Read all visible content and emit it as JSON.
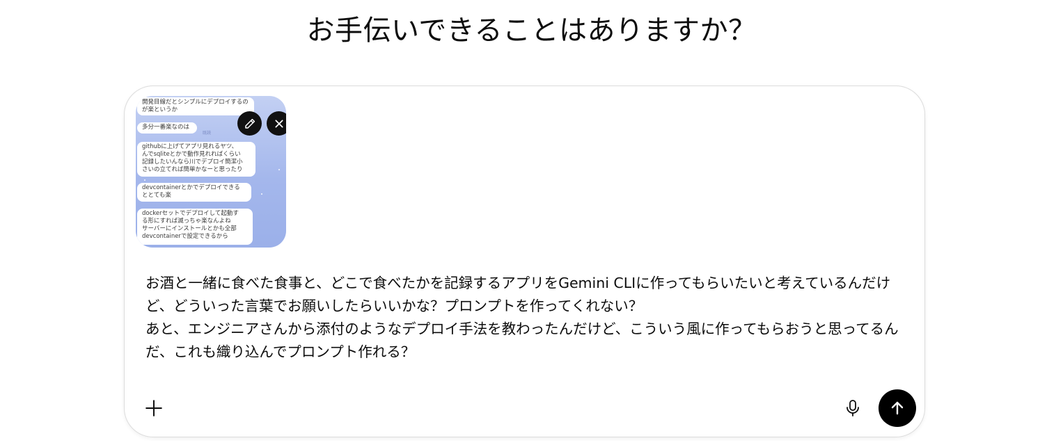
{
  "heading": "お手伝いできることはありますか？",
  "attachment": {
    "bubbles": [
      "開発目線だとシンプルにデプロイするのが楽というか",
      "多分一番楽なのは",
      "githubに上げてアプリ見れるヤツ、\nんでsqliteとかで動作見れればくらい\n記録したいんなら川でデプロイ簡潔小\nさいの立てれば簡単かなーと思ったり",
      "devcontainerとかでデプロイできる\nととても楽",
      "dockerセットでデプロイして起動す\nる形にすれば滅っちゃ楽なんよね\nサーバーにインストールとかも全部\ndevcontainerで設定できるから"
    ],
    "time_label": "既読"
  },
  "message": "お酒と一緒に食べた食事と、どこで食べたかを記録するアプリをGemini CLIに作ってもらいたいと考えているんだけど、どういった言葉でお願いしたらいいかな？プロンプトを作ってくれない？\nあと、エンジニアさんから添付のようなデプロイ手法を教わったんだけど、こういう風に作ってもらおうと思ってるんだ、これも織り込んでプロンプト作れる？",
  "icons": {
    "edit": "pencil-icon",
    "remove": "close-icon",
    "add": "plus-icon",
    "voice": "microphone-icon",
    "send": "arrow-up-icon"
  }
}
